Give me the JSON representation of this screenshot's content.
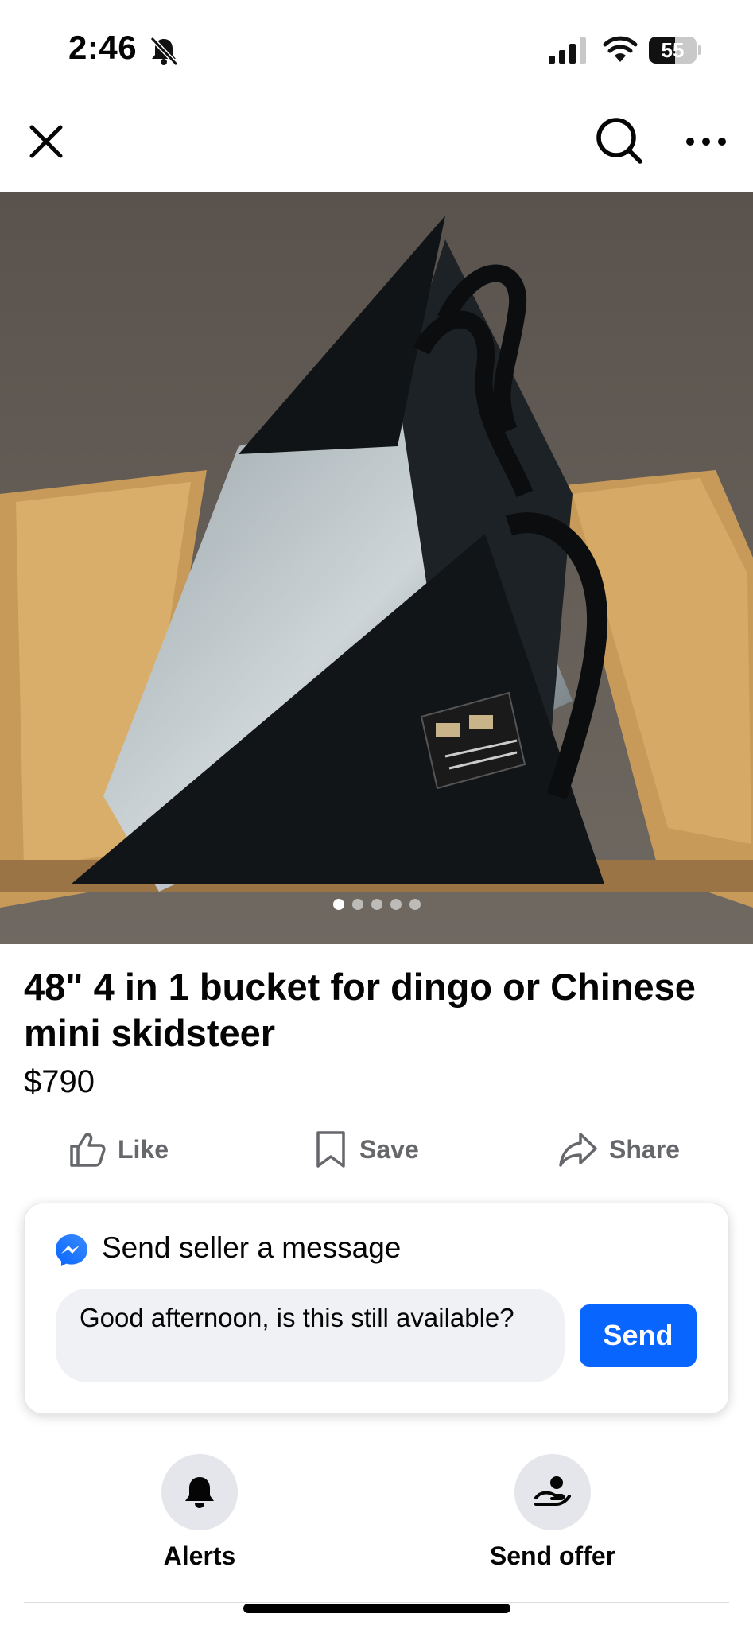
{
  "status_bar": {
    "time": "2:46",
    "battery_level": "55",
    "icons": [
      "bell-off-icon",
      "cellular-signal-icon",
      "wifi-icon",
      "battery-icon"
    ]
  },
  "nav": {
    "icons": [
      "close-icon",
      "search-icon",
      "more-icon"
    ]
  },
  "listing": {
    "photo": {
      "pages": 5,
      "current_page": 1
    },
    "title": "48\" 4 in 1 bucket for dingo or Chinese mini skidsteer",
    "price": "$790"
  },
  "actions": {
    "like_label": "Like",
    "save_label": "Save",
    "share_label": "Share"
  },
  "message_card": {
    "title": "Send seller a message",
    "message_value": "Good afternoon, is this still available?",
    "send_label": "Send"
  },
  "bottom_actions": {
    "alerts_label": "Alerts",
    "send_offer_label": "Send offer"
  },
  "colors": {
    "accent": "#0866ff",
    "secondary_text": "#65676b",
    "input_bg": "#eff1f4",
    "circle_bg": "#e4e6eb"
  }
}
